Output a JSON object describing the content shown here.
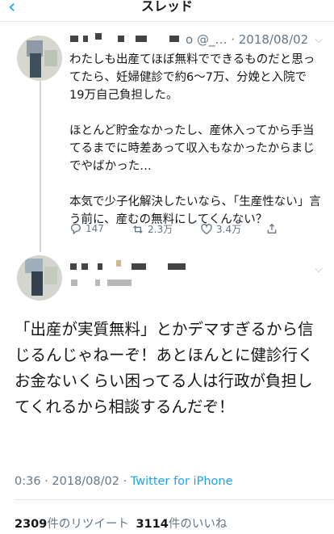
{
  "nav": {
    "back_icon": "chevron-left-icon",
    "title": "スレッド"
  },
  "parent_tweet": {
    "handle_date": "o @_… · 2018/08/02",
    "text": "わたしも出産てほぼ無料でできるものだと思ってたら、妊婦健診で約6〜7万、分娩と入院で19万自己負担した。\n\nほとんど貯金なかったし、産休入ってから手当てるまでに時差あって収入もなかったからまじでやばかった…\n\n本気で少子化解決したいなら、「生産性ない」言う前に、産むの無料にしてくんない？",
    "replies": "147",
    "retweets": "2.3万",
    "likes": "3.4万"
  },
  "main_tweet": {
    "text": "「出産が実質無料」とかデマすぎるから信じるんじゃねーぞ！あとほんとに健診行くお金ないくらい困ってる人は行政が負担してくれるから相談するんだぞ！",
    "time": "0:36 · 2018/08/02 · ",
    "source": "Twitter for iPhone",
    "retweet_count": "2309",
    "retweet_label": "件のリツイート",
    "like_count": "3114",
    "like_label": "件のいいね"
  },
  "colors": {
    "accent": "#1da1f2",
    "muted": "#657786",
    "text": "#14171a"
  }
}
